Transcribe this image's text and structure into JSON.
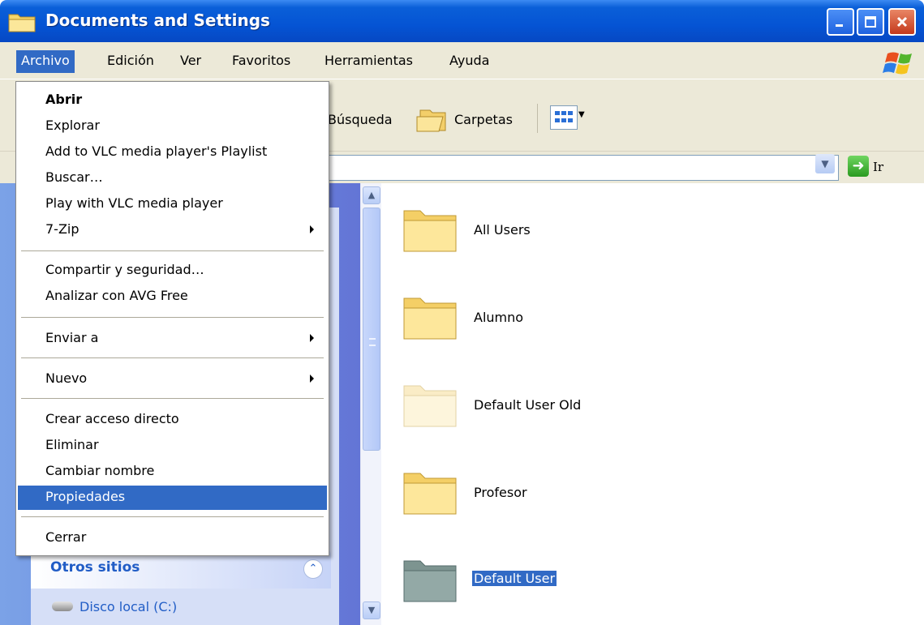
{
  "window": {
    "title": "Documents and Settings"
  },
  "menubar": {
    "items": [
      "Archivo",
      "Edición",
      "Ver",
      "Favoritos",
      "Herramientas",
      "Ayuda"
    ]
  },
  "toolbar": {
    "search_label": "Búsqueda",
    "folders_label": "Carpetas"
  },
  "addressbar": {
    "go_label": "Ir"
  },
  "file_menu": {
    "items": [
      "Abrir",
      "Explorar",
      "Add to VLC media player's Playlist",
      "Buscar…",
      "Play with VLC media player",
      "7-Zip",
      "Compartir y seguridad…",
      "Analizar con AVG Free",
      "Enviar a",
      "Nuevo",
      "Crear acceso directo",
      "Eliminar",
      "Cambiar nombre",
      "Propiedades",
      "Cerrar"
    ],
    "highlighted": "Propiedades"
  },
  "task_pane": {
    "other_places_title": "Otros sitios",
    "local_disk_label": "Disco local (C:)"
  },
  "folders": [
    {
      "name": "All Users",
      "style": "normal"
    },
    {
      "name": "Alumno",
      "style": "normal"
    },
    {
      "name": "Default User Old",
      "style": "faded"
    },
    {
      "name": "Profesor",
      "style": "normal"
    },
    {
      "name": "Default User",
      "style": "selected"
    }
  ],
  "colors": {
    "titlebar_blue": "#0554d4",
    "selection_blue": "#316ac5",
    "xp_chrome": "#ece9d8",
    "taskpane_link": "#215dc6"
  }
}
